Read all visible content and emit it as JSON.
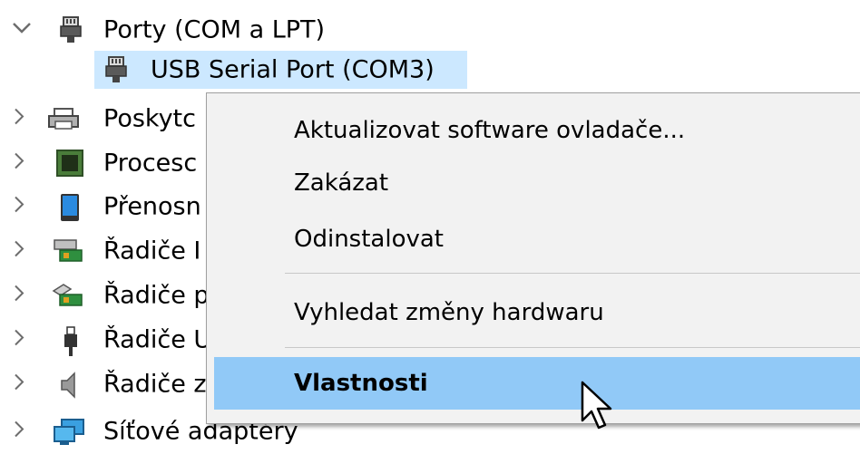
{
  "tree": {
    "ports": {
      "label": "Porty (COM a LPT)",
      "expanded": true
    },
    "usb_port": {
      "label": "USB Serial Port (COM3)",
      "selected": true
    },
    "items": [
      {
        "label": "Poskytc"
      },
      {
        "label": "Procesc"
      },
      {
        "label": "Přenosn"
      },
      {
        "label": "Řadiče I"
      },
      {
        "label": "Řadiče p"
      },
      {
        "label": "Řadiče U"
      },
      {
        "label": "Řadiče z"
      },
      {
        "label": "Síťové adaptéry"
      }
    ]
  },
  "context_menu": {
    "items": [
      {
        "label": "Aktualizovat software ovladače..."
      },
      {
        "label": "Zakázat"
      },
      {
        "label": "Odinstalovat"
      },
      {
        "label": "Vyhledat změny hardwaru"
      },
      {
        "label": "Vlastnosti",
        "highlighted": true,
        "bold": true
      }
    ]
  },
  "icons": {
    "expand": "chevron-down-icon",
    "collapse": "chevron-right-icon",
    "port": "serial-port-icon",
    "print_queue": "printer-icon",
    "processor": "processor-chip-icon",
    "portable": "portable-device-icon",
    "ide": "ide-controller-icon",
    "storage": "storage-controller-icon",
    "usb": "usb-plug-icon",
    "sound": "speaker-icon",
    "network": "network-adapter-icon"
  },
  "colors": {
    "selection": "#cce8ff",
    "menu_background": "#f2f2f2",
    "menu_highlight": "#91c9f7",
    "chevron": "#6d6d6d"
  }
}
